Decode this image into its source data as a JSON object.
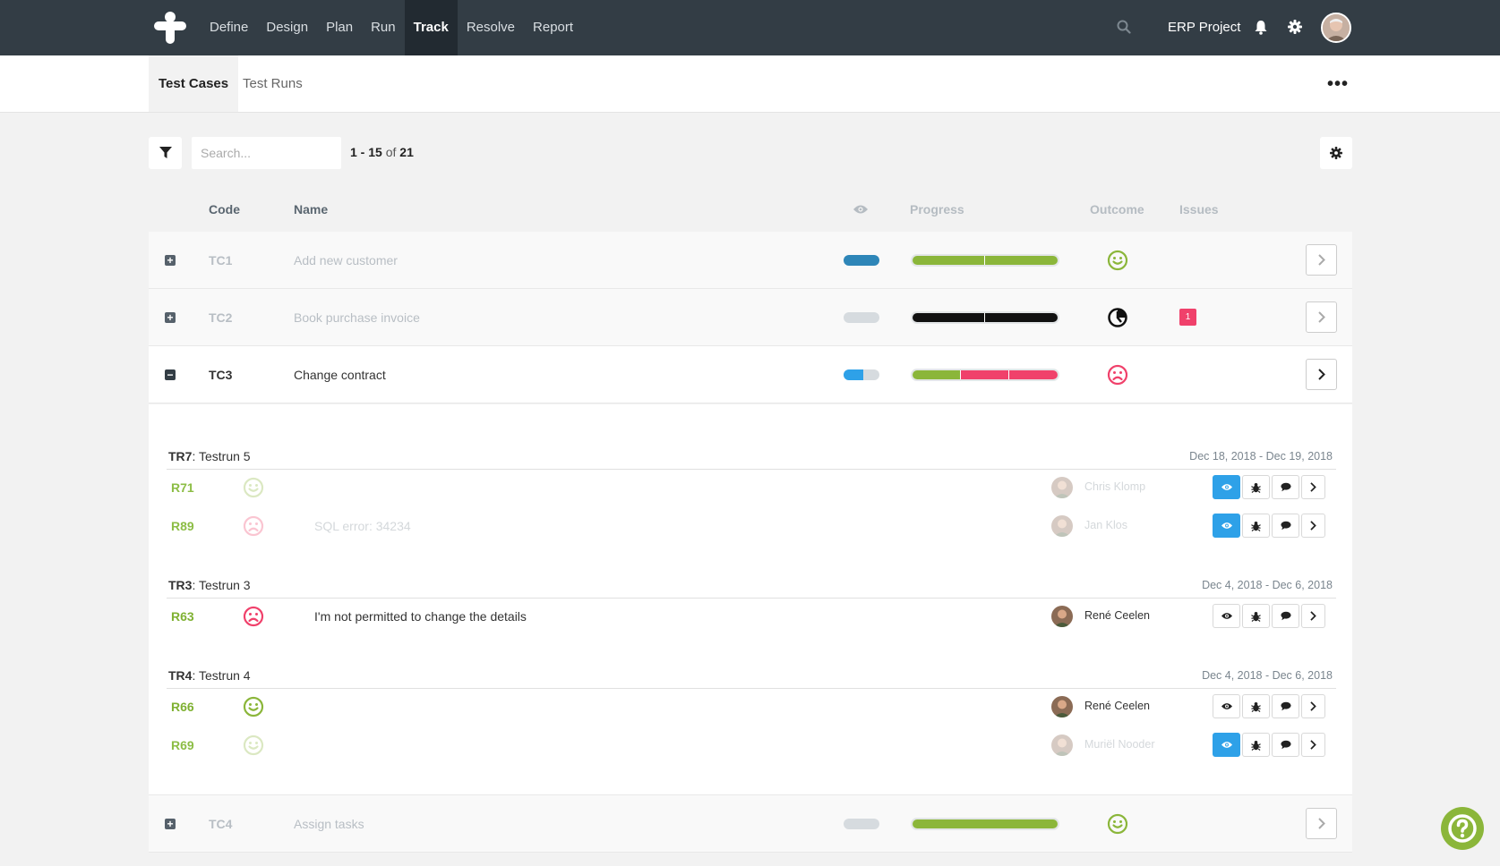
{
  "nav": {
    "items": [
      {
        "label": "Define",
        "active": false
      },
      {
        "label": "Design",
        "active": false
      },
      {
        "label": "Plan",
        "active": false
      },
      {
        "label": "Run",
        "active": false
      },
      {
        "label": "Track",
        "active": true
      },
      {
        "label": "Resolve",
        "active": false
      },
      {
        "label": "Report",
        "active": false
      }
    ],
    "project": "ERP Project",
    "icons": [
      "search-icon",
      "bell-icon",
      "gear-icon"
    ]
  },
  "subnav": {
    "tabs": [
      {
        "label": "Test Cases",
        "active": true
      },
      {
        "label": "Test Runs",
        "active": false
      }
    ],
    "more_icon": "more-icon"
  },
  "toolbar": {
    "search_placeholder": "Search...",
    "range": "1 - 15",
    "of": "of",
    "total": "21"
  },
  "columns": {
    "code": "Code",
    "name": "Name",
    "visibility_icon": "eye-icon",
    "progress": "Progress",
    "outcome": "Outcome",
    "issues": "Issues"
  },
  "colors": {
    "green": "#8bb63a",
    "red": "#f0416b",
    "blue": "#2ea1e8",
    "dark_blue": "#2e86b8",
    "black": "#111111",
    "track_gray": "#d6dbdf",
    "topbar": "#333d45"
  },
  "test_cases": [
    {
      "code": "TC1",
      "name": "Add new customer",
      "expanded": false,
      "visibility": {
        "fraction": 1.0,
        "color": "#2e86b8"
      },
      "progress": [
        {
          "fraction": 0.5,
          "color": "#8bb63a"
        },
        {
          "fraction": 0.5,
          "color": "#8bb63a"
        }
      ],
      "outcome": "happy",
      "issues": null
    },
    {
      "code": "TC2",
      "name": "Book purchase invoice",
      "expanded": false,
      "visibility": {
        "fraction": 0.0,
        "color": "#d6dbdf"
      },
      "progress": [
        {
          "fraction": 0.5,
          "color": "#111111"
        },
        {
          "fraction": 0.5,
          "color": "#111111"
        }
      ],
      "outcome": "in-progress",
      "issues": "1"
    },
    {
      "code": "TC3",
      "name": "Change contract",
      "expanded": true,
      "visibility": {
        "fraction": 0.55,
        "color": "#2ea1e8"
      },
      "progress": [
        {
          "fraction": 0.333,
          "color": "#8bb63a"
        },
        {
          "fraction": 0.333,
          "color": "#f0416b"
        },
        {
          "fraction": 0.334,
          "color": "#f0416b"
        }
      ],
      "outcome": "sad",
      "issues": null
    },
    {
      "code": "TC4",
      "name": "Assign tasks",
      "expanded": false,
      "visibility": {
        "fraction": 0.0,
        "color": "#d6dbdf"
      },
      "progress": [
        {
          "fraction": 1.0,
          "color": "#8bb63a"
        }
      ],
      "outcome": "happy",
      "issues": null
    }
  ],
  "test_runs": [
    {
      "code": "TR7",
      "name": "Testrun 5",
      "dates": "Dec 18, 2018 - Dec 19, 2018",
      "results": [
        {
          "code": "R71",
          "outcome": "happy",
          "comment": "",
          "tester": "Chris Klomp",
          "dim": true,
          "visible": true
        },
        {
          "code": "R89",
          "outcome": "sad",
          "comment": "SQL error: 34234",
          "tester": "Jan Klos",
          "dim": true,
          "visible": true
        }
      ]
    },
    {
      "code": "TR3",
      "name": "Testrun 3",
      "dates": "Dec 4, 2018 - Dec 6, 2018",
      "results": [
        {
          "code": "R63",
          "outcome": "sad",
          "comment": "I'm not permitted to change the details",
          "tester": "René Ceelen",
          "dim": false,
          "visible": false
        }
      ]
    },
    {
      "code": "TR4",
      "name": "Testrun 4",
      "dates": "Dec 4, 2018 - Dec 6, 2018",
      "results": [
        {
          "code": "R66",
          "outcome": "happy",
          "comment": "",
          "tester": "René Ceelen",
          "dim": false,
          "visible": false
        },
        {
          "code": "R69",
          "outcome": "happy",
          "comment": "",
          "tester": "Muriël Nooder",
          "dim": true,
          "visible": true
        }
      ]
    }
  ],
  "result_action_icons": [
    "eye-icon",
    "bug-icon",
    "comment-icon",
    "chevron-right-icon"
  ],
  "help_icon": "help-icon"
}
